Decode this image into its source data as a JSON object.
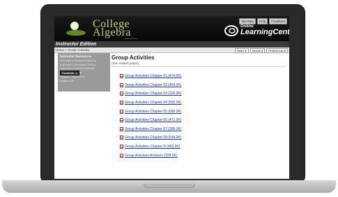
{
  "header": {
    "brand_line1": "College",
    "brand_line2": "Algebra",
    "brand_tagline": "Stewart/Redlin/Watson",
    "olc_online": "Online",
    "olc_name": "LearningCenter",
    "top_links": [
      "Site Map",
      "Help",
      "Feedback"
    ]
  },
  "edition": "Instructor Edition",
  "breadcrumb": "Home > Group Activities",
  "menus": [
    "Notes ▾",
    "Search ▾",
    "Preferences ▾"
  ],
  "sidebar": {
    "heading": "Instructor Resources",
    "items": [
      {
        "label": "Instructor's Resource Manual",
        "active": false
      },
      {
        "label": "Instructor's Annotated Edition",
        "active": false
      },
      {
        "label": "Instructor's Solution Manual",
        "active": false
      },
      {
        "label": "Group Activities",
        "active": true
      },
      {
        "label": "Chapter Summaries",
        "active": false
      },
      {
        "label": "Algebra Kit",
        "active": false
      }
    ],
    "contents_button": "Contents ▲"
  },
  "content": {
    "title": "Group Activities",
    "subtitle": "(See related pages)",
    "files": [
      "Group Activities Chapter 01 (474.0K)",
      "Group Activities Chapter 02 (469.0K)",
      "Group Activities Chapter 03 (326.0K)",
      "Group Activities Chapter 04 (502.0K)",
      "Group Activities Chapter 05 (680.0K)",
      "Group Activities Chapter 06 (471.0K)",
      "Group Activities Chapter 07 (386.0K)",
      "Group Activities Chapter 08 (544.0K)",
      "Group Activities Chapter R (462.0K)",
      "Group Activities Answers (328.0K)"
    ]
  },
  "colors": {
    "brand_text": "#c3d27a",
    "link": "#1a3aa8",
    "sidebar_bg": "#9a9a9a",
    "header_bg": "#0a0a0a"
  }
}
